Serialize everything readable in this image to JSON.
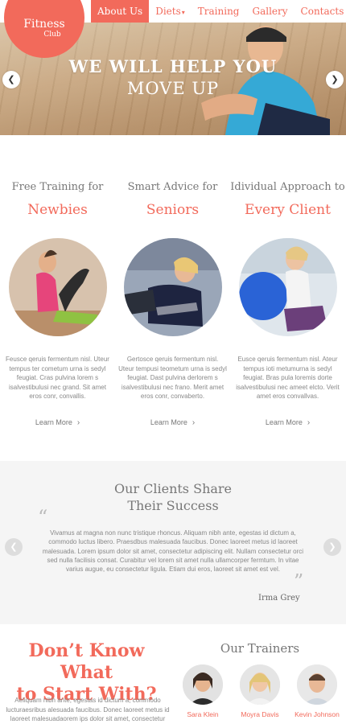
{
  "brand": {
    "name": "Fitness",
    "sub": "Club",
    "accent": "#f26a5b"
  },
  "nav": {
    "items": [
      {
        "label": "About Us",
        "active": true
      },
      {
        "label": "Diets",
        "caret": true
      },
      {
        "label": "Training"
      },
      {
        "label": "Gallery"
      },
      {
        "label": "Contacts"
      }
    ]
  },
  "hero": {
    "line1": "WE WILL HELP YOU",
    "line2": "MOVE UP",
    "prev_icon": "chevron-left-icon",
    "next_icon": "chevron-right-icon"
  },
  "features": [
    {
      "top": "Free Training for",
      "big": "Newbies",
      "text": "Feusce qeruis fermentum nisl. Uteur tempus ter cometum urna is sedyl feugiat. Cras pulvina lorem s isalvestibulusi nec grand. Sit amet eros conr, convallis.",
      "link": "Learn More"
    },
    {
      "top": "Smart Advice for",
      "big": "Seniors",
      "text": "Gertosce qeruis fermentum nisl. Uteur tempusi teometum urna is sedyl feugiat. Dast pulvina derlorem s isalvestibulusi nec frano. Merit amet eros conr, convaberto.",
      "link": "Learn More"
    },
    {
      "top": "Idividual Approach to",
      "big": "Every Client",
      "text": "Eusce qeruis fermentum nisl. Ateur tempus ioti metumurna is sedyl feugiat. Bras pula loremis dorte isalvestibulusi nec ameet elcto. Verit amet eros convallvas.",
      "link": "Learn More"
    }
  ],
  "testimonials": {
    "title_line1": "Our Clients Share",
    "title_line2": "Their Success",
    "quote": "Vivamus at magna non nunc tristique rhoncus. Aliquam nibh ante, egestas id dictum a, commodo luctus libero. Praesdbus malesuada faucibus. Donec laoreet metus id laoreet malesuada. Lorem ipsum dolor sit amet, consectetur adipiscing elit. Nullam consectetur orci sed nulla facilisis consat. Curabitur vel lorem sit amet nulla ullamcorper fermtum. In vitae varius augue, eu consectetur ligula. Etiam dui eros, laoreet sit amet est vel.",
    "author": "Irma Grey"
  },
  "cta": {
    "line1": "Don’t Know What",
    "line2": "to Start With?",
    "text": "Aeliquam nibh ante, egestas id dictum a, commodo lucturaesribus alesuada faucibus. Donec laoreet metus id laoreet malesuadaorem ips dolor sit amet, consectetur"
  },
  "trainers": {
    "title": "Our Trainers",
    "people": [
      {
        "name": "Sara Klein"
      },
      {
        "name": "Moyra Davis"
      },
      {
        "name": "Kevin Johnson"
      }
    ]
  }
}
